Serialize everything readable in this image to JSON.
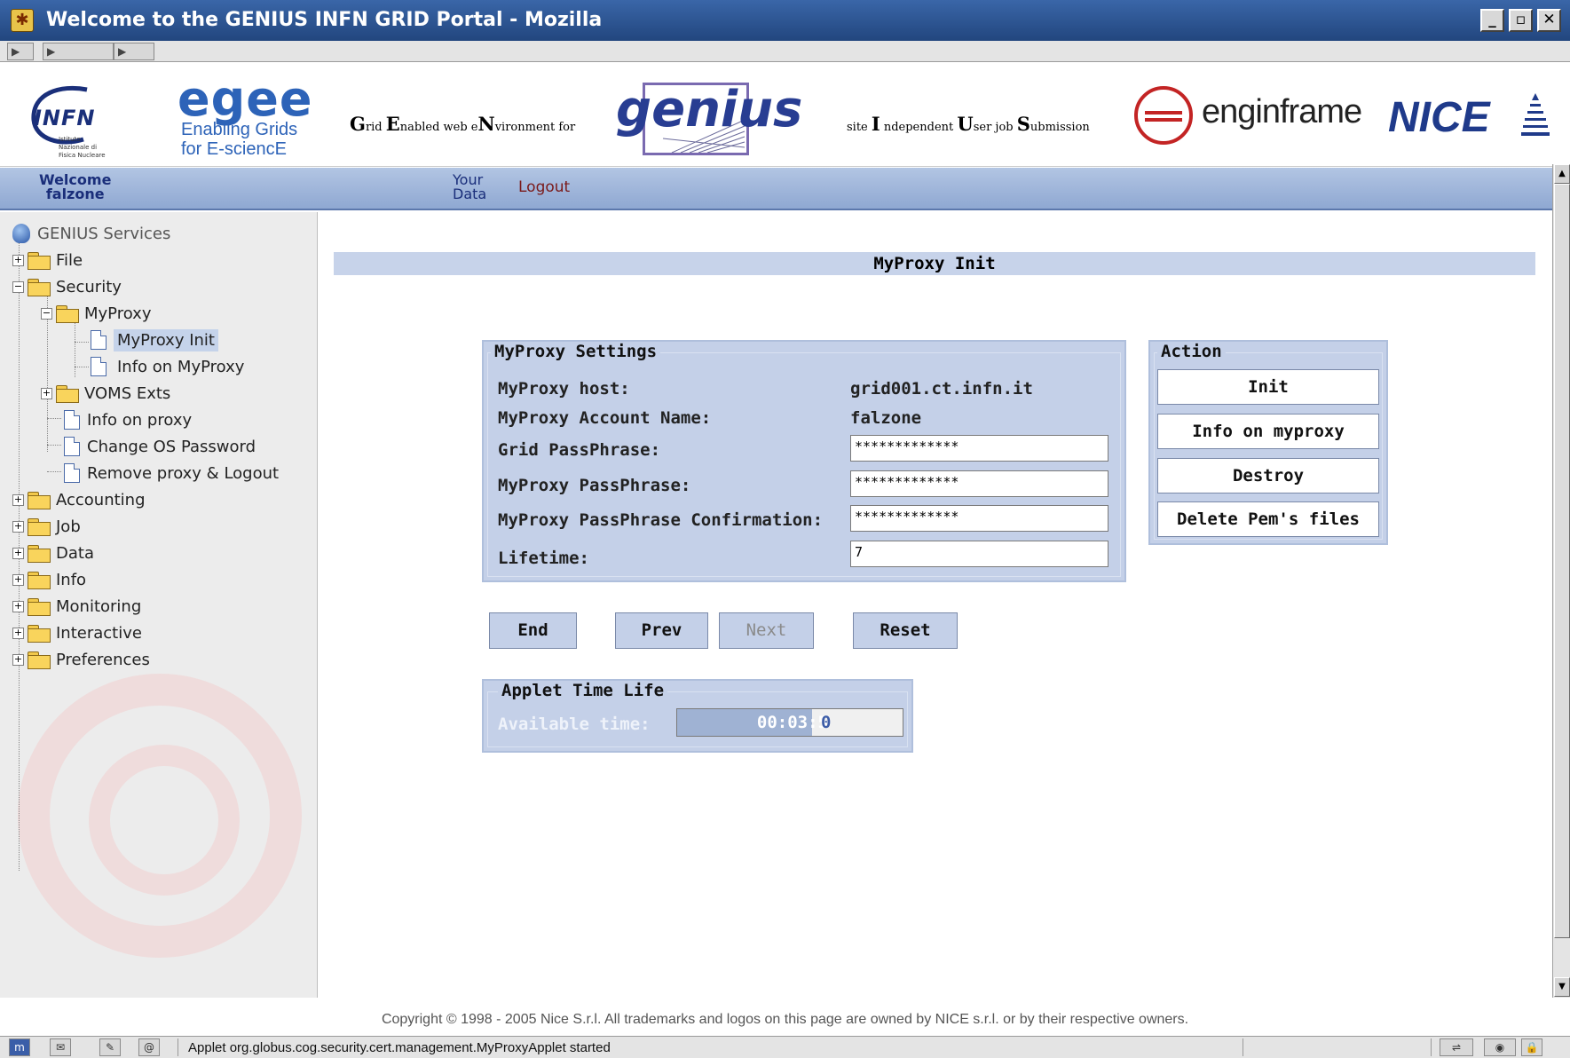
{
  "window": {
    "title": "Welcome to the GENIUS INFN GRID Portal - Mozilla",
    "controls": [
      "_",
      "▫",
      "✕"
    ]
  },
  "banner": {
    "infn": {
      "name": "INFN",
      "sub": "Istituto Nazionale di Fisica Nucleare"
    },
    "egee": {
      "name": "egee",
      "tagline1": "Enabling Grids",
      "tagline2": "for E-sciencE"
    },
    "genius_acronym": {
      "g": "G",
      "rid": "rid ",
      "e": "E",
      "nabled": "nabled web e",
      "n": "N",
      "vironment": "vironment for"
    },
    "genius_logo": "genius",
    "iujs": {
      "site": "site ",
      "i": "I",
      "ndependent": " ndependent ",
      "u": "U",
      "ser": "ser job ",
      "s": "S",
      "ubmission": "ubmission"
    },
    "enginframe": {
      "pre": "engin",
      "mid": "",
      "post": "frame"
    },
    "nice": "NICE"
  },
  "navbar": {
    "welcome_line1": "Welcome",
    "welcome_line2": "falzone",
    "your_data_line1": "Your",
    "your_data_line2": "Data",
    "logout": "Logout"
  },
  "sidebar": {
    "root": "GENIUS Services",
    "items": [
      {
        "label": "File",
        "type": "folder",
        "expander": "+"
      },
      {
        "label": "Security",
        "type": "folder",
        "expander": "−"
      },
      {
        "label": "MyProxy",
        "type": "folder",
        "expander": "−"
      },
      {
        "label": "MyProxy Init",
        "type": "doc",
        "selected": true
      },
      {
        "label": "Info on MyProxy",
        "type": "doc"
      },
      {
        "label": "VOMS Exts",
        "type": "folder",
        "expander": "+"
      },
      {
        "label": "Info on proxy",
        "type": "doc"
      },
      {
        "label": "Change OS Password",
        "type": "doc"
      },
      {
        "label": "Remove proxy & Logout",
        "type": "doc"
      },
      {
        "label": "Accounting",
        "type": "folder",
        "expander": "+"
      },
      {
        "label": "Job",
        "type": "folder",
        "expander": "+"
      },
      {
        "label": "Data",
        "type": "folder",
        "expander": "+"
      },
      {
        "label": "Info",
        "type": "folder",
        "expander": "+"
      },
      {
        "label": "Monitoring",
        "type": "folder",
        "expander": "+"
      },
      {
        "label": "Interactive",
        "type": "folder",
        "expander": "+"
      },
      {
        "label": "Preferences",
        "type": "folder",
        "expander": "+"
      }
    ]
  },
  "main": {
    "heading": "MyProxy Init",
    "settings": {
      "legend": "MyProxy Settings",
      "host_label": "MyProxy host:",
      "host_value": "grid001.ct.infn.it",
      "account_label": "MyProxy Account Name:",
      "account_value": "falzone",
      "grid_pass_label": "Grid PassPhrase:",
      "grid_pass_value": "*************",
      "myproxy_pass_label": "MyProxy PassPhrase:",
      "myproxy_pass_value": "*************",
      "confirm_label": "MyProxy PassPhrase Confirmation:",
      "confirm_value": "*************",
      "lifetime_label": "Lifetime:",
      "lifetime_value": "7"
    },
    "action": {
      "legend": "Action",
      "init": "Init",
      "info": "Info on myproxy",
      "destroy": "Destroy",
      "delete_pem": "Delete Pem's files"
    },
    "wizard": {
      "end": "End",
      "prev": "Prev",
      "next": "Next",
      "reset": "Reset"
    },
    "applet": {
      "legend": "Applet Time Life",
      "available_label": "Available time:",
      "time_part1": "00:03:5",
      "time_part2": "0",
      "progress_fraction": 0.6
    }
  },
  "footer": {
    "copyright": "Copyright © 1998 - 2005 Nice S.r.l. All trademarks and logos on this page are owned by NICE s.r.l. or by their respective owners."
  },
  "statusbar": {
    "text": "Applet org.globus.cog.security.cert.management.MyProxyApplet started"
  },
  "colors": {
    "titlebar": "#2d5595",
    "navbar": "#a2b8dc",
    "panel": "#c4d0e8",
    "heading_bar": "#c7d3ea"
  }
}
